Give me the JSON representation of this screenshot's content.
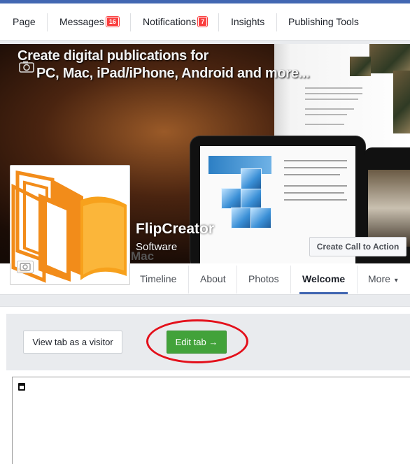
{
  "admin_nav": {
    "items": [
      {
        "label": "Page"
      },
      {
        "label": "Messages",
        "badge": "16"
      },
      {
        "label": "Notifications",
        "badge": "7"
      },
      {
        "label": "Insights"
      },
      {
        "label": "Publishing Tools"
      }
    ]
  },
  "cover": {
    "headline_line1": "Create digital publications for",
    "headline_line2": "PC, Mac, iPad/iPhone, Android and more...",
    "device_caption": "Mac"
  },
  "page": {
    "name": "FlipCreator",
    "category": "Software",
    "cta_label": "Create Call to Action"
  },
  "tabs": [
    {
      "label": "Timeline"
    },
    {
      "label": "About"
    },
    {
      "label": "Photos"
    },
    {
      "label": "Welcome",
      "active": true
    },
    {
      "label": "More",
      "suffix": "▾"
    }
  ],
  "toolbar": {
    "view_as_visitor_label": "View tab as a visitor",
    "edit_tab_label": "Edit tab →"
  },
  "colors": {
    "brand_blue": "#4267b2",
    "badge_red": "#fa3e3e",
    "edit_green": "#42a23a",
    "annotation_red": "#e3101b",
    "logo_orange": "#f28c1a"
  },
  "icons": {
    "cover_camera": "camera-icon",
    "profile_camera": "camera-icon",
    "more_caret": "caret-down-icon",
    "frame_placeholder": "broken-frame-icon"
  }
}
